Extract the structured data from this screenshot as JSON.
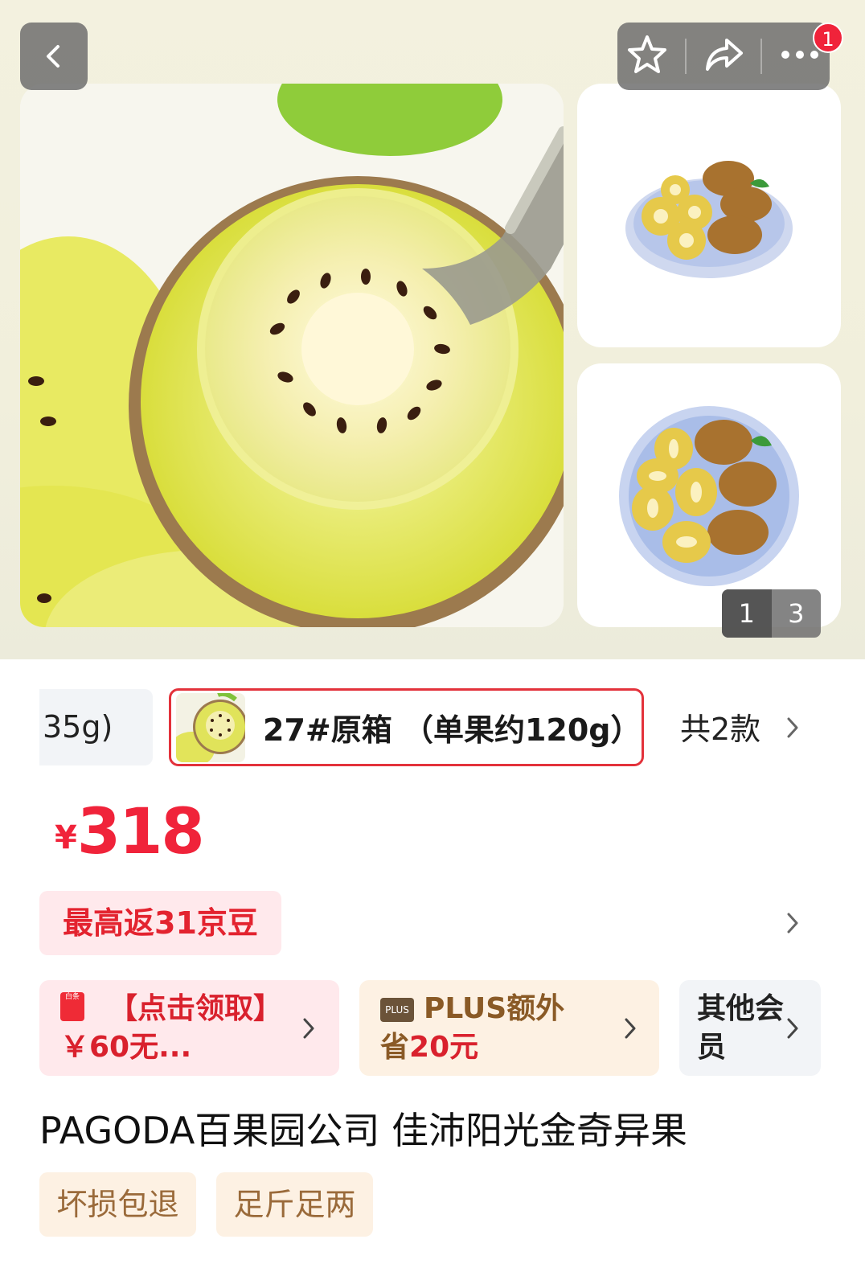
{
  "header": {
    "back_icon": "chevron-left-icon",
    "actions": [
      "star-icon",
      "share-icon",
      "more-icon"
    ],
    "notification_count": "1"
  },
  "gallery": {
    "current_page": "1",
    "total_pages": "3"
  },
  "variants": {
    "previous_label": "35g)",
    "selected_label": "27#原箱 （单果约120g）",
    "count_label": "共2款"
  },
  "price": {
    "currency": "¥",
    "value": "318"
  },
  "rebate": {
    "label": "最高返31京豆"
  },
  "promos": {
    "white_bar": {
      "text": "【点击领取】￥60无...",
      "icon": "iou-card-icon",
      "icon_text": "白条"
    },
    "plus": {
      "icon_text": "PLUS",
      "text_1": "PLUS额外",
      "text_2_prefix": "省",
      "amount": "20元"
    },
    "other": {
      "text": "其他会员"
    }
  },
  "product": {
    "title": "PAGODA百果园公司 佳沛阳光金奇异果"
  },
  "tags": [
    "坏损包退",
    "足斤足两"
  ],
  "colors": {
    "accent_red": "#f0233a",
    "plus_brown": "#8a5a26",
    "tag_bg": "#fdf1e3"
  }
}
